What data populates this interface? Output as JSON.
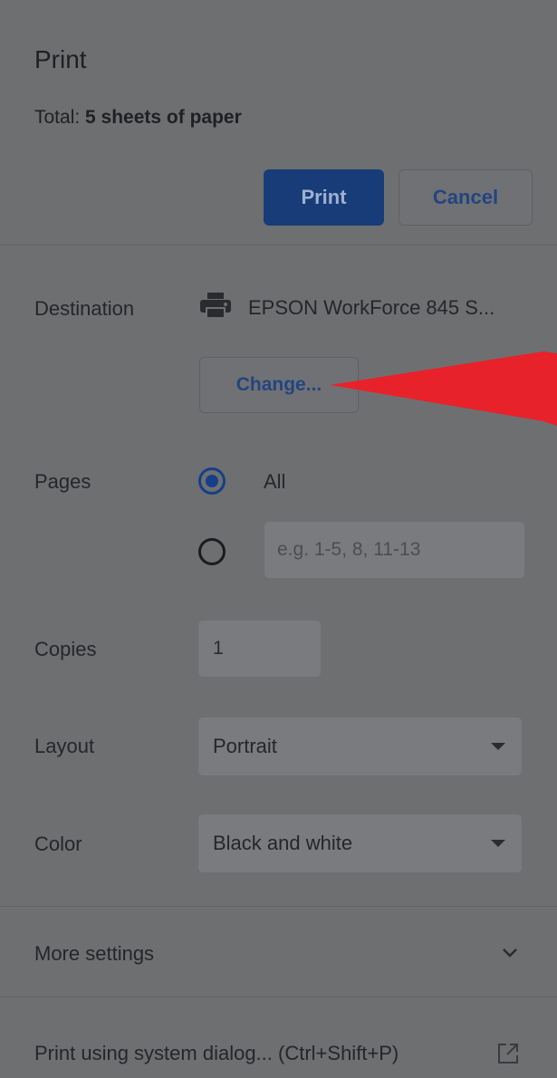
{
  "dialog": {
    "title": "Print",
    "total_prefix": "Total: ",
    "total_value": "5 sheets of paper",
    "print_button": "Print",
    "cancel_button": "Cancel"
  },
  "destination": {
    "label": "Destination",
    "printer_icon": "printer-icon",
    "printer_name": "EPSON WorkForce 845 S...",
    "change_button": "Change..."
  },
  "pages": {
    "label": "Pages",
    "all_option": "All",
    "all_selected": true,
    "custom_placeholder": "e.g. 1-5, 8, 11-13"
  },
  "copies": {
    "label": "Copies",
    "value": "1"
  },
  "layout": {
    "label": "Layout",
    "selected": "Portrait"
  },
  "color": {
    "label": "Color",
    "selected": "Black and white"
  },
  "more_settings": {
    "label": "More settings",
    "icon": "chevron-down-icon"
  },
  "system_dialog": {
    "label": "Print using system dialog... (Ctrl+Shift+P)",
    "icon": "open-external-icon"
  },
  "annotation": {
    "arrow_color": "#e8222a"
  },
  "colors": {
    "overlay": "#6e6f71",
    "primary_button": "#173c77",
    "link_text": "#23457f"
  }
}
